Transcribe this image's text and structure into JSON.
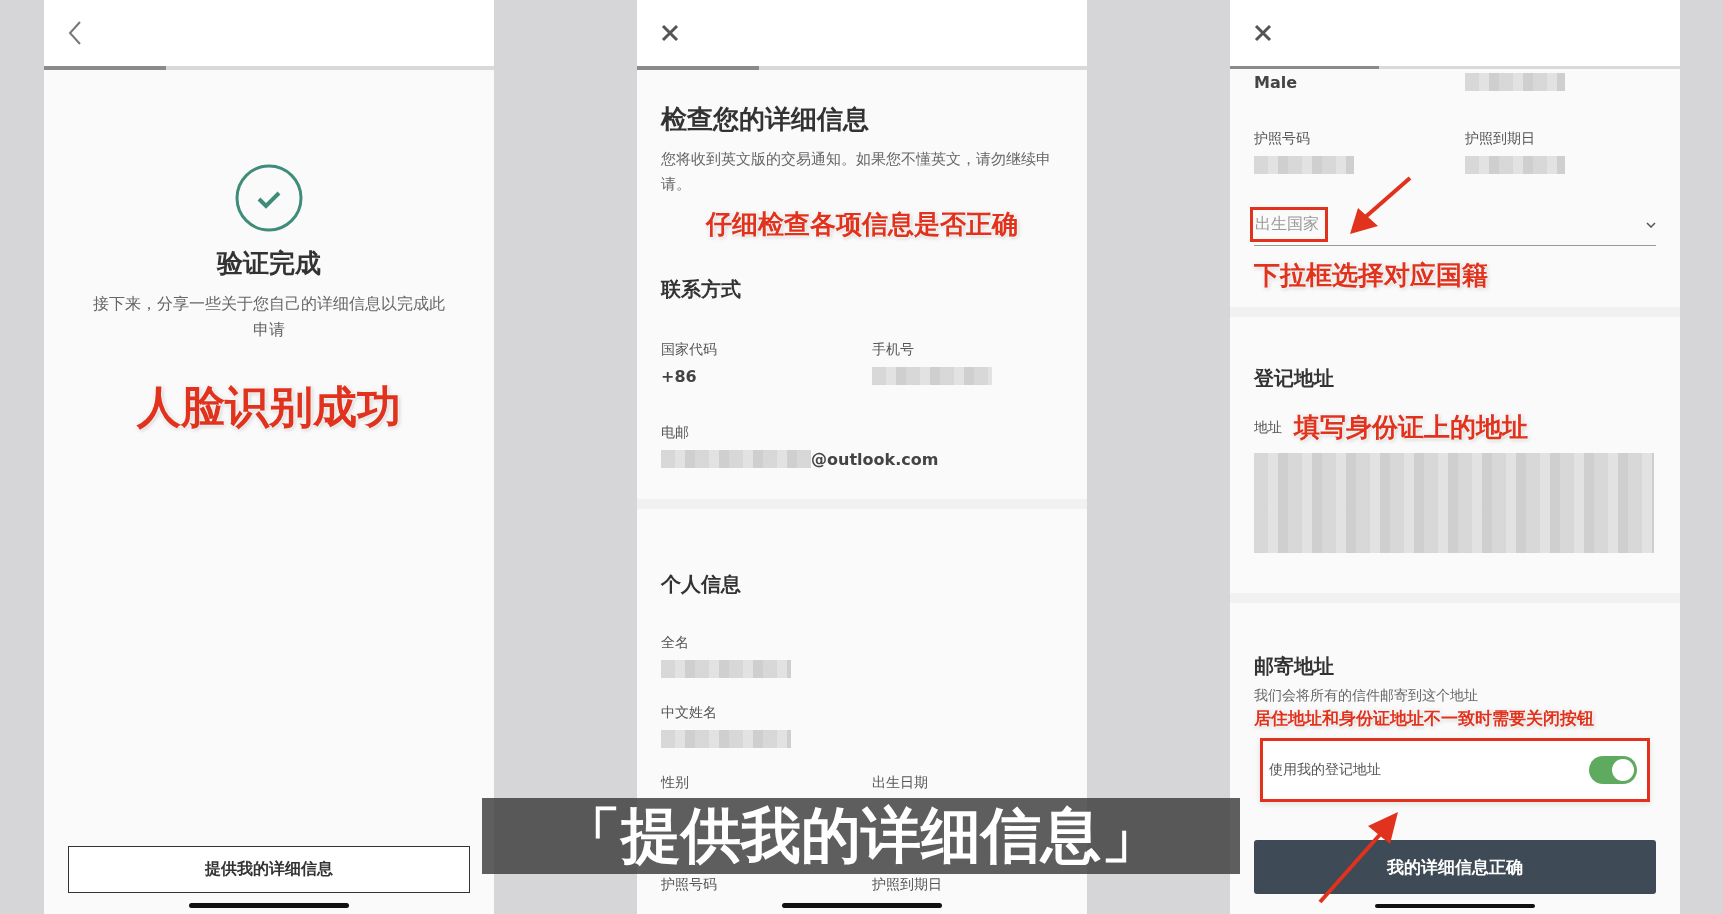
{
  "verification_screen": {
    "progress": {
      "level": 0.27
    },
    "title": "验证完成",
    "description": "接下来，分享一些关于您自己的详细信息以完成此申请",
    "annotation": "人脸识别成功",
    "button": "提供我的详细信息"
  },
  "review_screen": {
    "progress": {
      "level": 0.27
    },
    "title": "检查您的详细信息",
    "description": "您将收到英文版的交易通知。如果您不懂英文，请勿继续申请。",
    "annotation": "仔细检查各项信息是否正确",
    "sections": [
      {
        "heading": "联系方式",
        "rows": [
          [
            {
              "label": "国家代码",
              "value": "+86",
              "redacted": false
            },
            {
              "label": "手机号",
              "redacted": true
            }
          ],
          [
            {
              "label": "电邮",
              "redacted": true,
              "value": "@outlook.com"
            }
          ]
        ]
      },
      {
        "heading": "个人信息",
        "rows": [
          [
            {
              "label": "全名",
              "redacted": true
            }
          ],
          [
            {
              "label": "中文姓名",
              "redacted": true
            }
          ],
          [
            {
              "label": "性别",
              "redacted": false
            },
            {
              "label": "出生日期",
              "redacted": false
            }
          ],
          [
            {
              "label": "护照号码",
              "redacted": false
            },
            {
              "label": "护照到期日",
              "redacted": false
            }
          ]
        ]
      }
    ]
  },
  "address_screen": {
    "progress": {
      "level": 0.33
    },
    "rows": [
      [
        {
          "value": "Male",
          "redacted": false
        },
        {
          "redacted": true
        }
      ],
      [
        {
          "label": "护照号码",
          "redacted": true
        },
        {
          "label": "护照到期日",
          "redacted": true
        }
      ]
    ],
    "country_select": {
      "placeholder": "出生国家",
      "annotation": "下拉框选择对应国籍"
    },
    "registered_address": {
      "heading": "登记地址",
      "label": "地址",
      "annotation": "填写身份证上的地址"
    },
    "mailing_address": {
      "heading": "邮寄地址",
      "description": "我们会将所有的信件邮寄到这个地址",
      "annotation": "居住地址和身份证地址不一致时需要关闭按钮",
      "toggle": {
        "label": "使用我的登记地址",
        "on": true
      }
    },
    "button": "我的详细信息正确"
  },
  "caption": "「提供我的详细信息」"
}
